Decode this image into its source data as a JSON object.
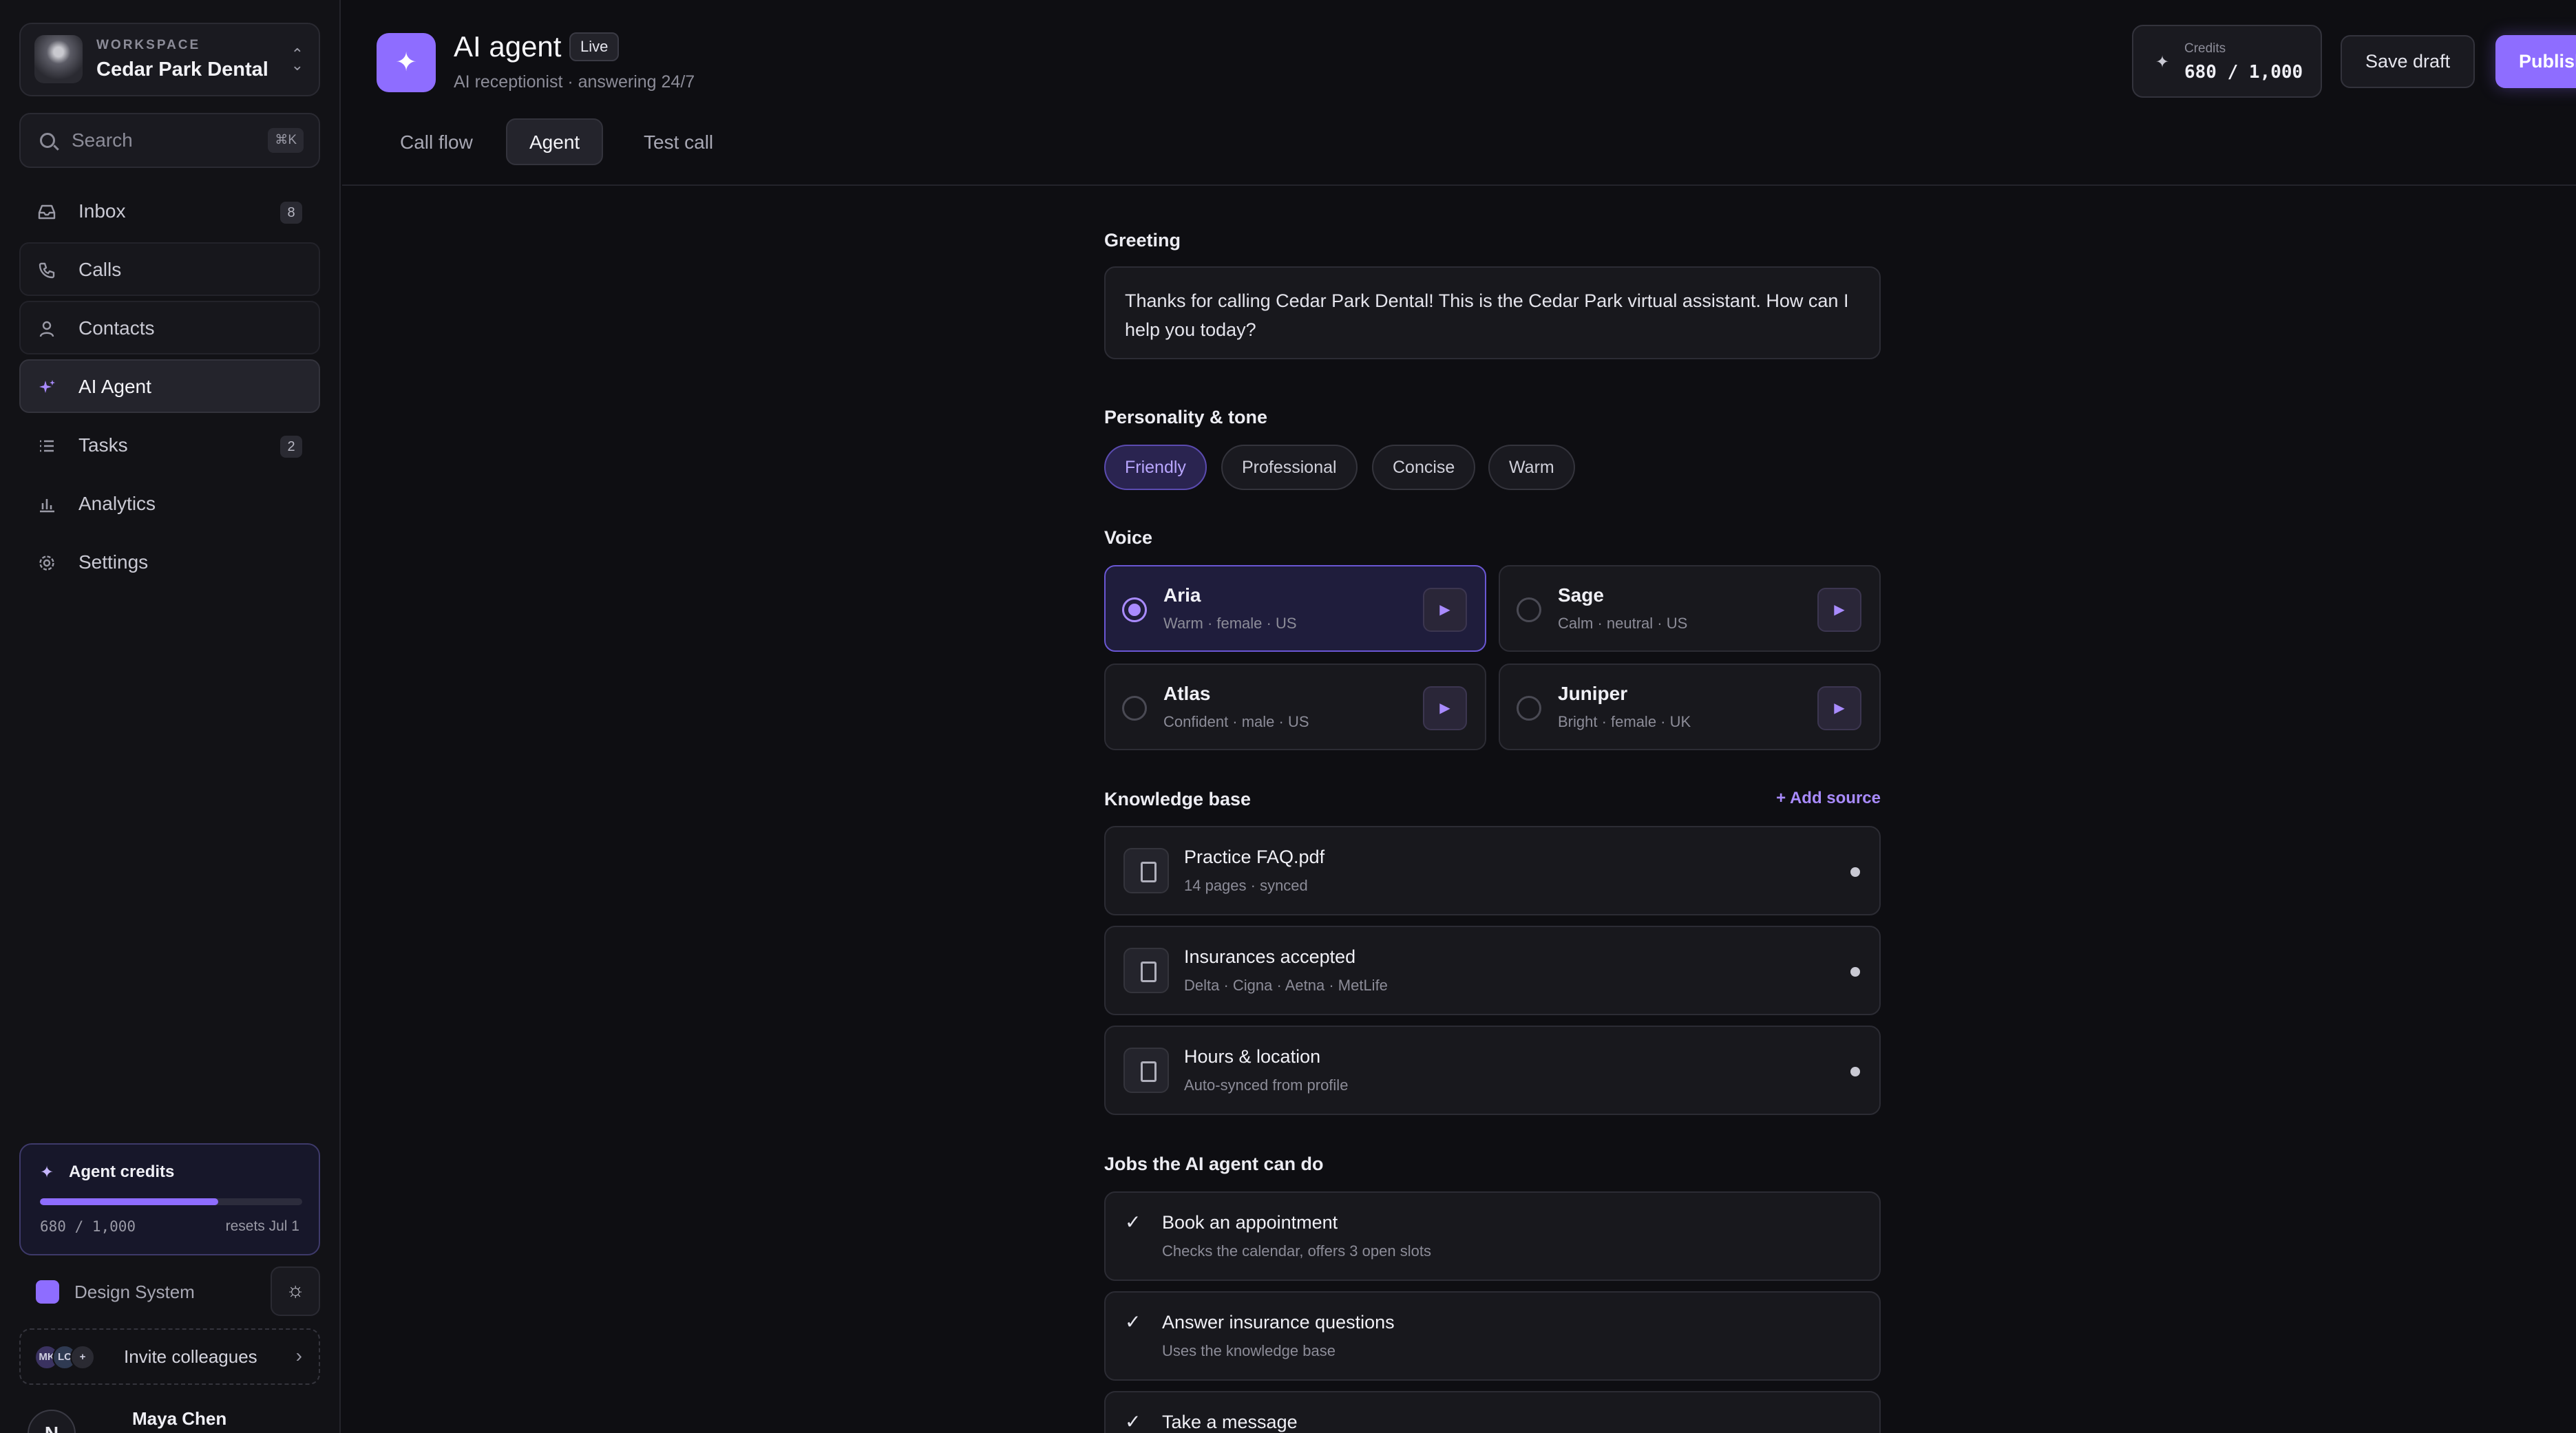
{
  "workspace": {
    "eyebrow": "WORKSPACE",
    "name": "Cedar Park Dental"
  },
  "search": {
    "placeholder": "Search",
    "shortcut": "⌘K"
  },
  "sidebar": {
    "items": [
      {
        "label": "Inbox",
        "icon": "inbox-icon",
        "badge": "8"
      },
      {
        "label": "Calls",
        "icon": "phone-icon",
        "badge": ""
      },
      {
        "label": "Contacts",
        "icon": "user-icon",
        "badge": ""
      },
      {
        "label": "AI Agent",
        "icon": "sparkle-icon",
        "badge": "",
        "active": true
      },
      {
        "label": "Tasks",
        "icon": "list-icon",
        "badge": "2"
      },
      {
        "label": "Analytics",
        "icon": "bar-chart-icon",
        "badge": ""
      },
      {
        "label": "Settings",
        "icon": "gear-icon",
        "badge": ""
      }
    ],
    "credits": {
      "title": "Agent credits",
      "count": "680 / 1,000",
      "reset": "resets Jul 1",
      "used_fraction": 0.68
    },
    "design_system": "Design System",
    "invite": {
      "label": "Invite colleagues",
      "avatars": [
        "MK",
        "LC",
        "+"
      ]
    },
    "user": {
      "name": "Maya Chen",
      "initial": "N"
    }
  },
  "header": {
    "title": "AI agent",
    "status": "Live",
    "subtitle": "AI receptionist · answering 24/7",
    "tabs": [
      {
        "label": "Call flow"
      },
      {
        "label": "Agent",
        "active": true
      },
      {
        "label": "Test call"
      }
    ],
    "credits_label": "Credits",
    "credits_value": "680 / 1,000",
    "save_draft": "Save draft",
    "publish": "Publish"
  },
  "greeting": {
    "label": "Greeting",
    "text": "Thanks for calling Cedar Park Dental! This is the Cedar Park virtual assistant. How can I help you today?"
  },
  "tone": {
    "label": "Personality & tone",
    "options": [
      "Friendly",
      "Professional",
      "Concise",
      "Warm"
    ],
    "selected": "Friendly"
  },
  "voice": {
    "label": "Voice",
    "options": [
      {
        "name": "Aria",
        "meta": "Warm · female · US",
        "selected": true
      },
      {
        "name": "Sage",
        "meta": "Calm · neutral · US"
      },
      {
        "name": "Atlas",
        "meta": "Confident · male · US"
      },
      {
        "name": "Juniper",
        "meta": "Bright · female · UK"
      }
    ]
  },
  "knowledge": {
    "label": "Knowledge base",
    "add": "+ Add source",
    "items": [
      {
        "title": "Practice FAQ.pdf",
        "meta": "14 pages · synced"
      },
      {
        "title": "Insurances accepted",
        "meta": "Delta · Cigna · Aetna · MetLife"
      },
      {
        "title": "Hours & location",
        "meta": "Auto-synced from profile"
      }
    ]
  },
  "jobs": {
    "label": "Jobs the AI agent can do",
    "items": [
      {
        "title": "Book an appointment",
        "meta": "Checks the calendar, offers 3 open slots"
      },
      {
        "title": "Answer insurance questions",
        "meta": "Uses the knowledge base"
      },
      {
        "title": "Take a message",
        "meta": ""
      }
    ]
  },
  "colors": {
    "accent": "#8e6dff",
    "background": "#0e0e12",
    "sidebar": "#121216"
  }
}
